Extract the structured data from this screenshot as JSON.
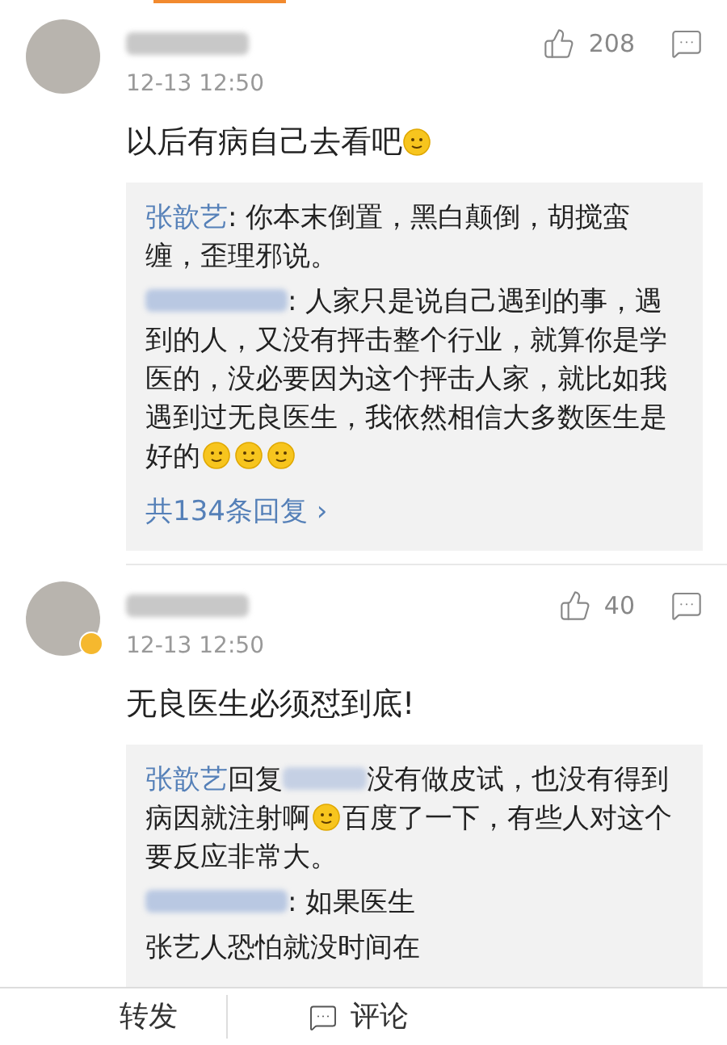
{
  "comments": [
    {
      "avatar_badge": false,
      "time": "12-13 12:50",
      "likes": "208",
      "text": "以后有病自己去看吧",
      "text_emoji": true,
      "replies": [
        {
          "parts": [
            {
              "kind": "author",
              "text": "张歆艺"
            },
            {
              "kind": "text",
              "text": ": 你本末倒置，黑白颠倒，胡搅蛮缠，歪理邪说。"
            }
          ]
        },
        {
          "parts": [
            {
              "kind": "blurred"
            },
            {
              "kind": "text",
              "text": ": 人家只是说自己遇到的事，遇到的人，又没有抨击整个行业，就算你是学医的，没必要因为这个抨击人家，就比如我遇到过无良医生，我依然相信大多数医生是好的"
            },
            {
              "kind": "emoji"
            },
            {
              "kind": "emoji"
            },
            {
              "kind": "emoji"
            }
          ]
        }
      ],
      "more_replies": "共134条回复 ›"
    },
    {
      "avatar_badge": true,
      "time": "12-13 12:50",
      "likes": "40",
      "text": "无良医生必须怼到底!",
      "text_emoji": false,
      "replies": [
        {
          "parts": [
            {
              "kind": "author",
              "text": "张歆艺"
            },
            {
              "kind": "text",
              "text": "回复"
            },
            {
              "kind": "mention"
            },
            {
              "kind": "text",
              "text": "没有做皮试，也没有得到病因就注射啊"
            },
            {
              "kind": "emoji"
            },
            {
              "kind": "text",
              "text": "百度了一下，有些人对这个要反应非常大。"
            }
          ]
        },
        {
          "parts": [
            {
              "kind": "blurred"
            },
            {
              "kind": "text",
              "text": ": 如果医生"
            }
          ]
        },
        {
          "parts": [
            {
              "kind": "text",
              "text": "张艺人恐怕就没时间在"
            }
          ]
        }
      ]
    }
  ],
  "bottom_bar": [
    {
      "label": "转发",
      "icon": false
    },
    {
      "label": "评论",
      "icon": true
    }
  ]
}
